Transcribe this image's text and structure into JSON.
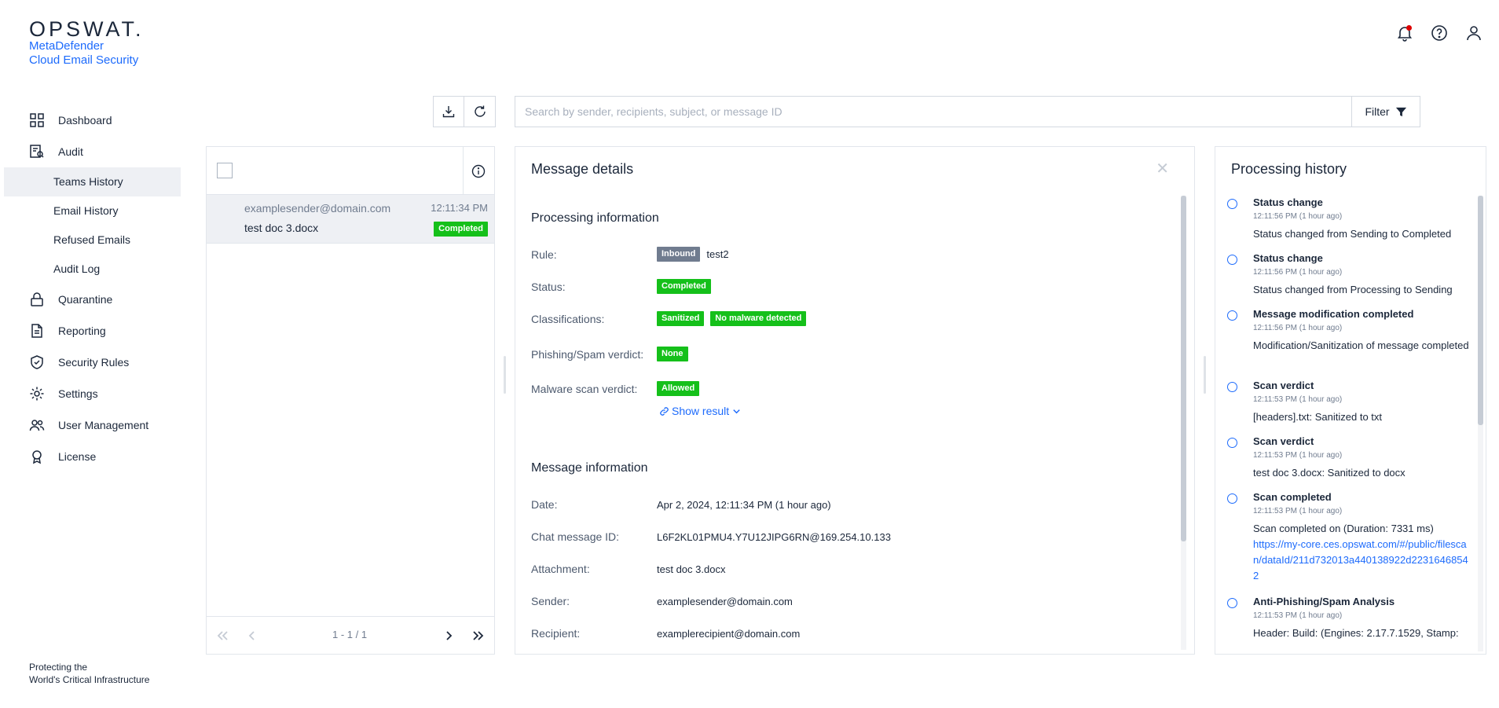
{
  "brand": {
    "logo": "OPSWAT.",
    "product_line1": "MetaDefender",
    "product_line2": "Cloud Email Security",
    "footer_line1": "Protecting the",
    "footer_line2": "World's Critical Infrastructure"
  },
  "header": {
    "icons": [
      "bell-icon",
      "help-icon",
      "user-icon"
    ]
  },
  "sidebar": {
    "items": [
      {
        "label": "Dashboard",
        "icon": "dashboard-icon"
      },
      {
        "label": "Audit",
        "icon": "audit-icon"
      },
      {
        "label": "Quarantine",
        "icon": "lock-icon"
      },
      {
        "label": "Reporting",
        "icon": "document-icon"
      },
      {
        "label": "Security Rules",
        "icon": "shield-check-icon"
      },
      {
        "label": "Settings",
        "icon": "gear-icon"
      },
      {
        "label": "User Management",
        "icon": "users-icon"
      },
      {
        "label": "License",
        "icon": "license-icon"
      }
    ],
    "audit_sub": [
      "Teams History",
      "Email History",
      "Refused Emails",
      "Audit Log"
    ],
    "active_sub": "Teams History"
  },
  "toolbar": {
    "search_placeholder": "Search by sender, recipients, subject, or message ID",
    "filter_label": "Filter"
  },
  "list": {
    "messages": [
      {
        "sender": "examplesender@domain.com",
        "time": "12:11:34 PM",
        "subject": "test doc 3.docx",
        "status": "Completed"
      }
    ],
    "pagination": "1 - 1 / 1"
  },
  "details": {
    "title": "Message details",
    "processing_title": "Processing information",
    "rule_label": "Rule:",
    "rule_badge": "Inbound",
    "rule_value": "test2",
    "status_label": "Status:",
    "status_value": "Completed",
    "classifications_label": "Classifications:",
    "classifications": [
      "Sanitized",
      "No malware detected"
    ],
    "phishing_label": "Phishing/Spam verdict:",
    "phishing_value": "None",
    "malware_label": "Malware scan verdict:",
    "malware_value": "Allowed",
    "show_result": "Show result",
    "message_title": "Message information",
    "date_label": "Date:",
    "date_value": "Apr 2, 2024, 12:11:34 PM (1 hour ago)",
    "chat_id_label": "Chat message ID:",
    "chat_id_value": "L6F2KL01PMU4.Y7U12JIPG6RN@169.254.10.133",
    "attachment_label": "Attachment:",
    "attachment_value": "test doc 3.docx",
    "sender_label": "Sender:",
    "sender_value": "examplesender@domain.com",
    "recipient_label": "Recipient:",
    "recipient_value": "examplerecipient@domain.com"
  },
  "history": {
    "title": "Processing history",
    "items": [
      {
        "title": "Status change",
        "time": "12:11:56 PM (1 hour ago)",
        "text": "Status changed from Sending to Completed"
      },
      {
        "title": "Status change",
        "time": "12:11:56 PM (1 hour ago)",
        "text": "Status changed from Processing to Sending"
      },
      {
        "title": "Message modification completed",
        "time": "12:11:56 PM (1 hour ago)",
        "text": "Modification/Sanitization of message completed"
      },
      {
        "title": "Scan verdict",
        "time": "12:11:53 PM (1 hour ago)",
        "text": "[headers].txt: Sanitized to txt"
      },
      {
        "title": "Scan verdict",
        "time": "12:11:53 PM (1 hour ago)",
        "text": "test doc 3.docx: Sanitized to docx"
      },
      {
        "title": "Scan completed",
        "time": "12:11:53 PM (1 hour ago)",
        "text": "Scan completed on (Duration: 7331 ms)",
        "link": "https://my-core.ces.opswat.com/#/public/filescan/dataId/211d732013a440138922d22316468542"
      },
      {
        "title": "Anti-Phishing/Spam Analysis",
        "time": "12:11:53 PM (1 hour ago)",
        "text": "Header: Build: (Engines: 2.17.7.1529, Stamp:"
      }
    ]
  },
  "colors": {
    "accent": "#1d6bfc",
    "success": "#15c01a",
    "neutral_badge": "#707c8f",
    "active_bg": "#eef0f4"
  }
}
